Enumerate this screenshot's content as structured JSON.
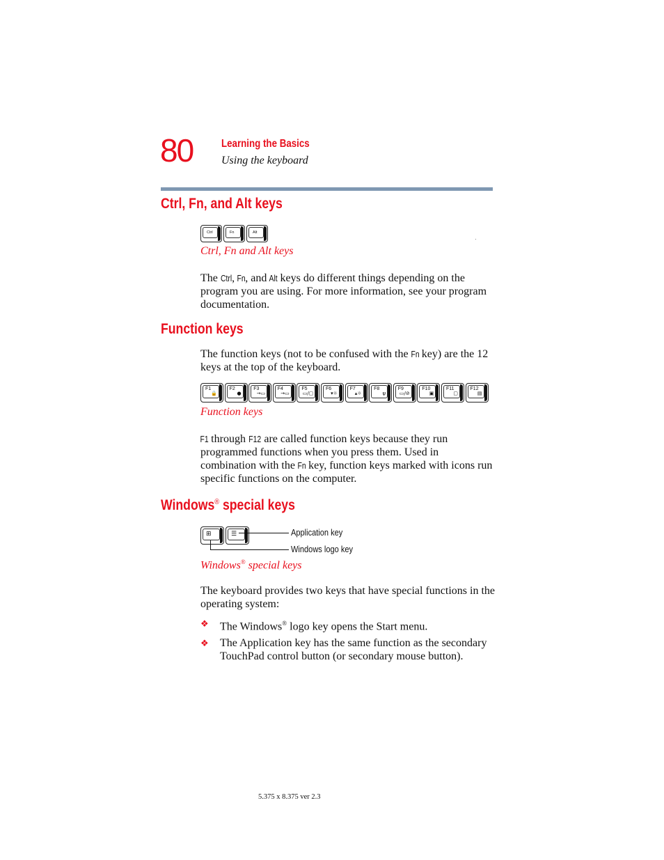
{
  "header": {
    "page_number": "80",
    "chapter": "Learning the Basics",
    "section": "Using the keyboard"
  },
  "sections": {
    "ctrl_fn_alt": {
      "heading": "Ctrl, Fn, and Alt keys",
      "keys": [
        "Ctrl",
        "Fn",
        "Alt"
      ],
      "caption": "Ctrl, Fn and Alt keys",
      "body": {
        "t1": "The ",
        "k1": "Ctrl",
        "t2": ", ",
        "k2": "Fn",
        "t3": ", and ",
        "k3": "Alt",
        "t4": " keys do different things depending on the program you are using. For more information, see your program documentation."
      }
    },
    "function_keys": {
      "heading": "Function keys",
      "intro": {
        "t1": "The function keys (not to be confused with the ",
        "k1": "Fn",
        "t2": " key) are the 12 keys at the top of the keyboard."
      },
      "keys": [
        {
          "label": "F1",
          "icon": "lock-icon",
          "glyph": "🔒"
        },
        {
          "label": "F2",
          "icon": "power-save-icon",
          "glyph": "●"
        },
        {
          "label": "F3",
          "icon": "standby-icon",
          "glyph": "→▭"
        },
        {
          "label": "F4",
          "icon": "hibernate-icon",
          "glyph": "→▭"
        },
        {
          "label": "F5",
          "icon": "display-switch-icon",
          "glyph": "▭/▢"
        },
        {
          "label": "F6",
          "icon": "brightness-down-icon",
          "glyph": "▾☼"
        },
        {
          "label": "F7",
          "icon": "brightness-up-icon",
          "glyph": "▴☼"
        },
        {
          "label": "F8",
          "icon": "wireless-icon",
          "glyph": "ψ"
        },
        {
          "label": "F9",
          "icon": "touchpad-toggle-icon",
          "glyph": "▭/⊘"
        },
        {
          "label": "F10",
          "icon": "cursor-control-icon",
          "glyph": "▣"
        },
        {
          "label": "F11",
          "icon": "numeric-overlay-icon",
          "glyph": "▢"
        },
        {
          "label": "F12",
          "icon": "scroll-lock-icon",
          "glyph": "▤"
        }
      ],
      "caption": "Function keys",
      "body": {
        "k1": "F1",
        "t1": " through ",
        "k2": "F12",
        "t2": " are called function keys because they run programmed functions when you press them. Used in combination with the ",
        "k3": "Fn",
        "t3": " key, function keys marked with icons run specific functions on the computer."
      }
    },
    "windows_keys": {
      "heading": "Windows",
      "heading_reg": "®",
      "heading_rest": " special keys",
      "callouts": {
        "application_key": "Application key",
        "windows_logo_key": "Windows logo key"
      },
      "caption": "Windows",
      "caption_reg": "®",
      "caption_rest": " special keys",
      "body": "The keyboard provides two keys that have special functions in the operating system:",
      "bullets": [
        {
          "pre": "The Windows",
          "reg": "®",
          "post": " logo key opens the Start menu."
        },
        {
          "pre": "The Application key has the same function as the secondary TouchPad control button (or secondary mouse button).",
          "reg": "",
          "post": ""
        }
      ],
      "bullet_glyph": "❖"
    }
  },
  "footer": "5.375 x 8.375 ver 2.3",
  "colors": {
    "accent_red": "#e8101e",
    "rule_blue": "#7f98b2"
  }
}
